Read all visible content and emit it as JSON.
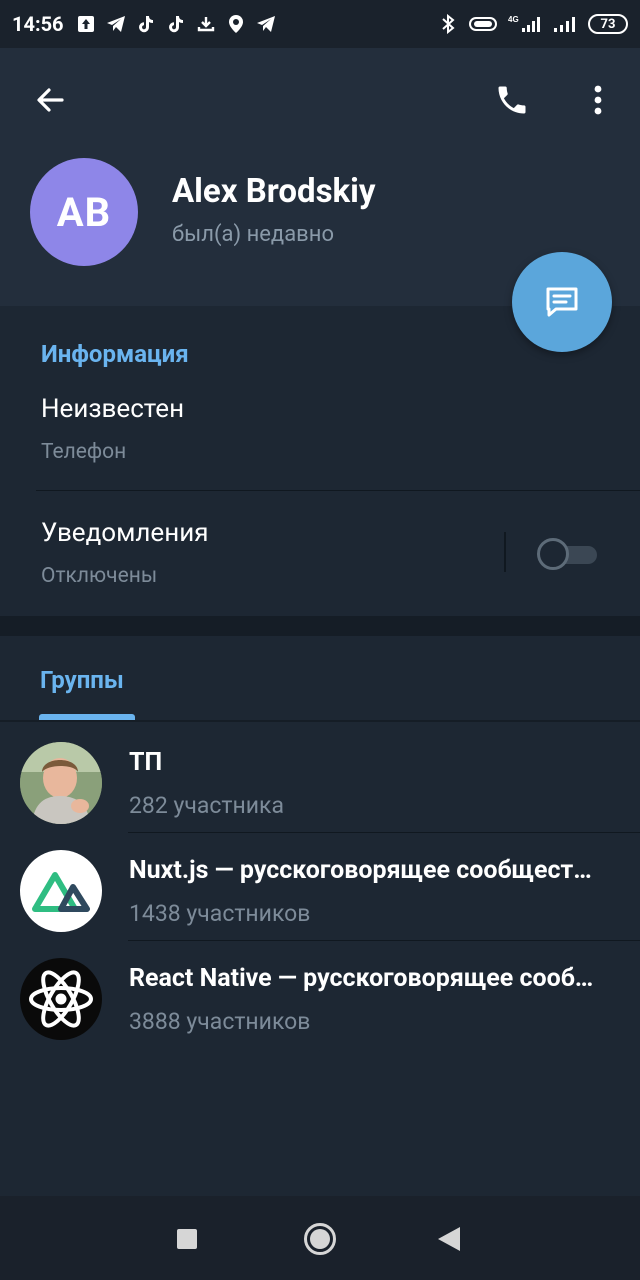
{
  "status_bar": {
    "time": "14:56",
    "battery": "73",
    "network": "4G"
  },
  "header": {
    "avatar_initials": "AB",
    "avatar_color": "#8e86e8",
    "name": "Alex Brodskiy",
    "last_seen": "был(а) недавно"
  },
  "info": {
    "title": "Информация",
    "phone_value": "Неизвестен",
    "phone_label": "Телефон",
    "notifications_title": "Уведомления",
    "notifications_status": "Отключены",
    "notifications_enabled": false
  },
  "groups": {
    "tab_label": "Группы",
    "items": [
      {
        "name": "ТП",
        "count": "282 участника"
      },
      {
        "name": "Nuxt.js — русскоговорящее сообщество",
        "count": "1438 участников"
      },
      {
        "name": "React Native — русскоговорящее сообщество",
        "count": "3888 участников"
      }
    ]
  },
  "colors": {
    "accent": "#6ab4ef",
    "fab": "#5ba6db",
    "background": "#1d2733",
    "header": "#232e3c"
  }
}
